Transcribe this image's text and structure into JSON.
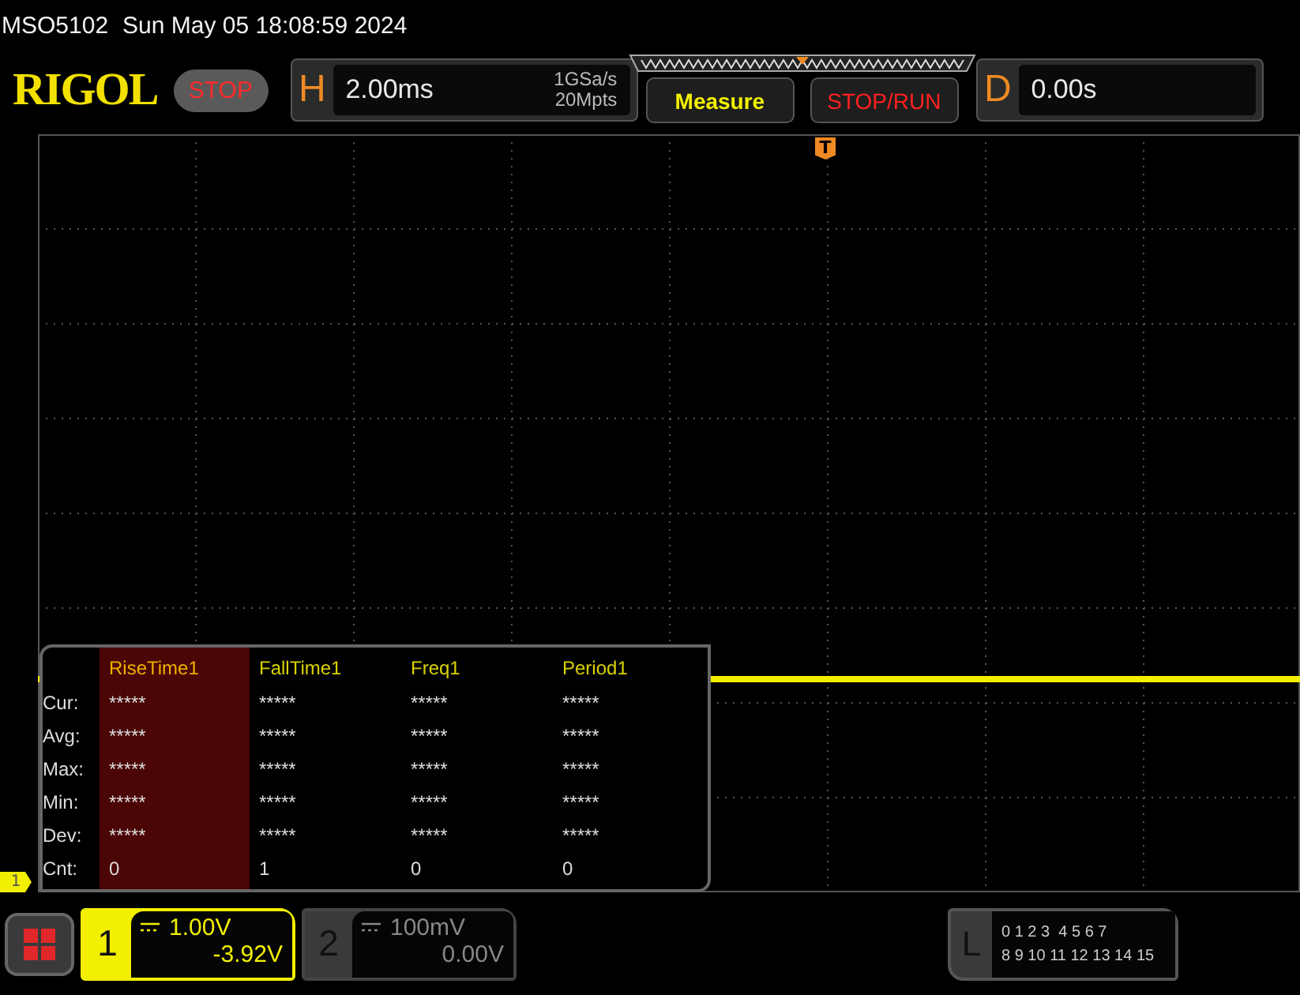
{
  "header": {
    "model": "MSO5102",
    "datetime": "Sun May 05 18:08:59 2024"
  },
  "toolbar": {
    "logo": "RIGOL",
    "run_state": "STOP",
    "horizontal": {
      "label": "H",
      "timebase": "2.00ms",
      "sample_rate": "1GSa/s",
      "memory_depth": "20Mpts"
    },
    "buttons": [
      {
        "label": "Measure",
        "kind": "measure"
      },
      {
        "label": "STOP/RUN",
        "kind": "stoprun"
      }
    ],
    "delay": {
      "label": "D",
      "value": "0.00s"
    }
  },
  "screen": {
    "trigger_marker": "T",
    "channel_marker": "1"
  },
  "measurements": {
    "row_labels": [
      "Cur:",
      "Avg:",
      "Max:",
      "Min:",
      "Dev:",
      "Cnt:"
    ],
    "columns": [
      {
        "name": "RiseTime1",
        "selected": true,
        "values": [
          "*****",
          "*****",
          "*****",
          "*****",
          "*****",
          "0"
        ]
      },
      {
        "name": "FallTime1",
        "selected": false,
        "values": [
          "*****",
          "*****",
          "*****",
          "*****",
          "*****",
          "1"
        ]
      },
      {
        "name": "Freq1",
        "selected": false,
        "values": [
          "*****",
          "*****",
          "*****",
          "*****",
          "*****",
          "0"
        ]
      },
      {
        "name": "Period1",
        "selected": false,
        "values": [
          "*****",
          "*****",
          "*****",
          "*****",
          "*****",
          "0"
        ]
      }
    ]
  },
  "channels": [
    {
      "number": "1",
      "scale": "1.00V",
      "offset": "-3.92V",
      "active": true
    },
    {
      "number": "2",
      "scale": "100mV",
      "offset": "0.00V",
      "active": false
    }
  ],
  "logic": {
    "label": "L",
    "rows": [
      "0 1 2 3  4 5 6 7",
      "8 9 10 11 12 13 14 15"
    ]
  }
}
